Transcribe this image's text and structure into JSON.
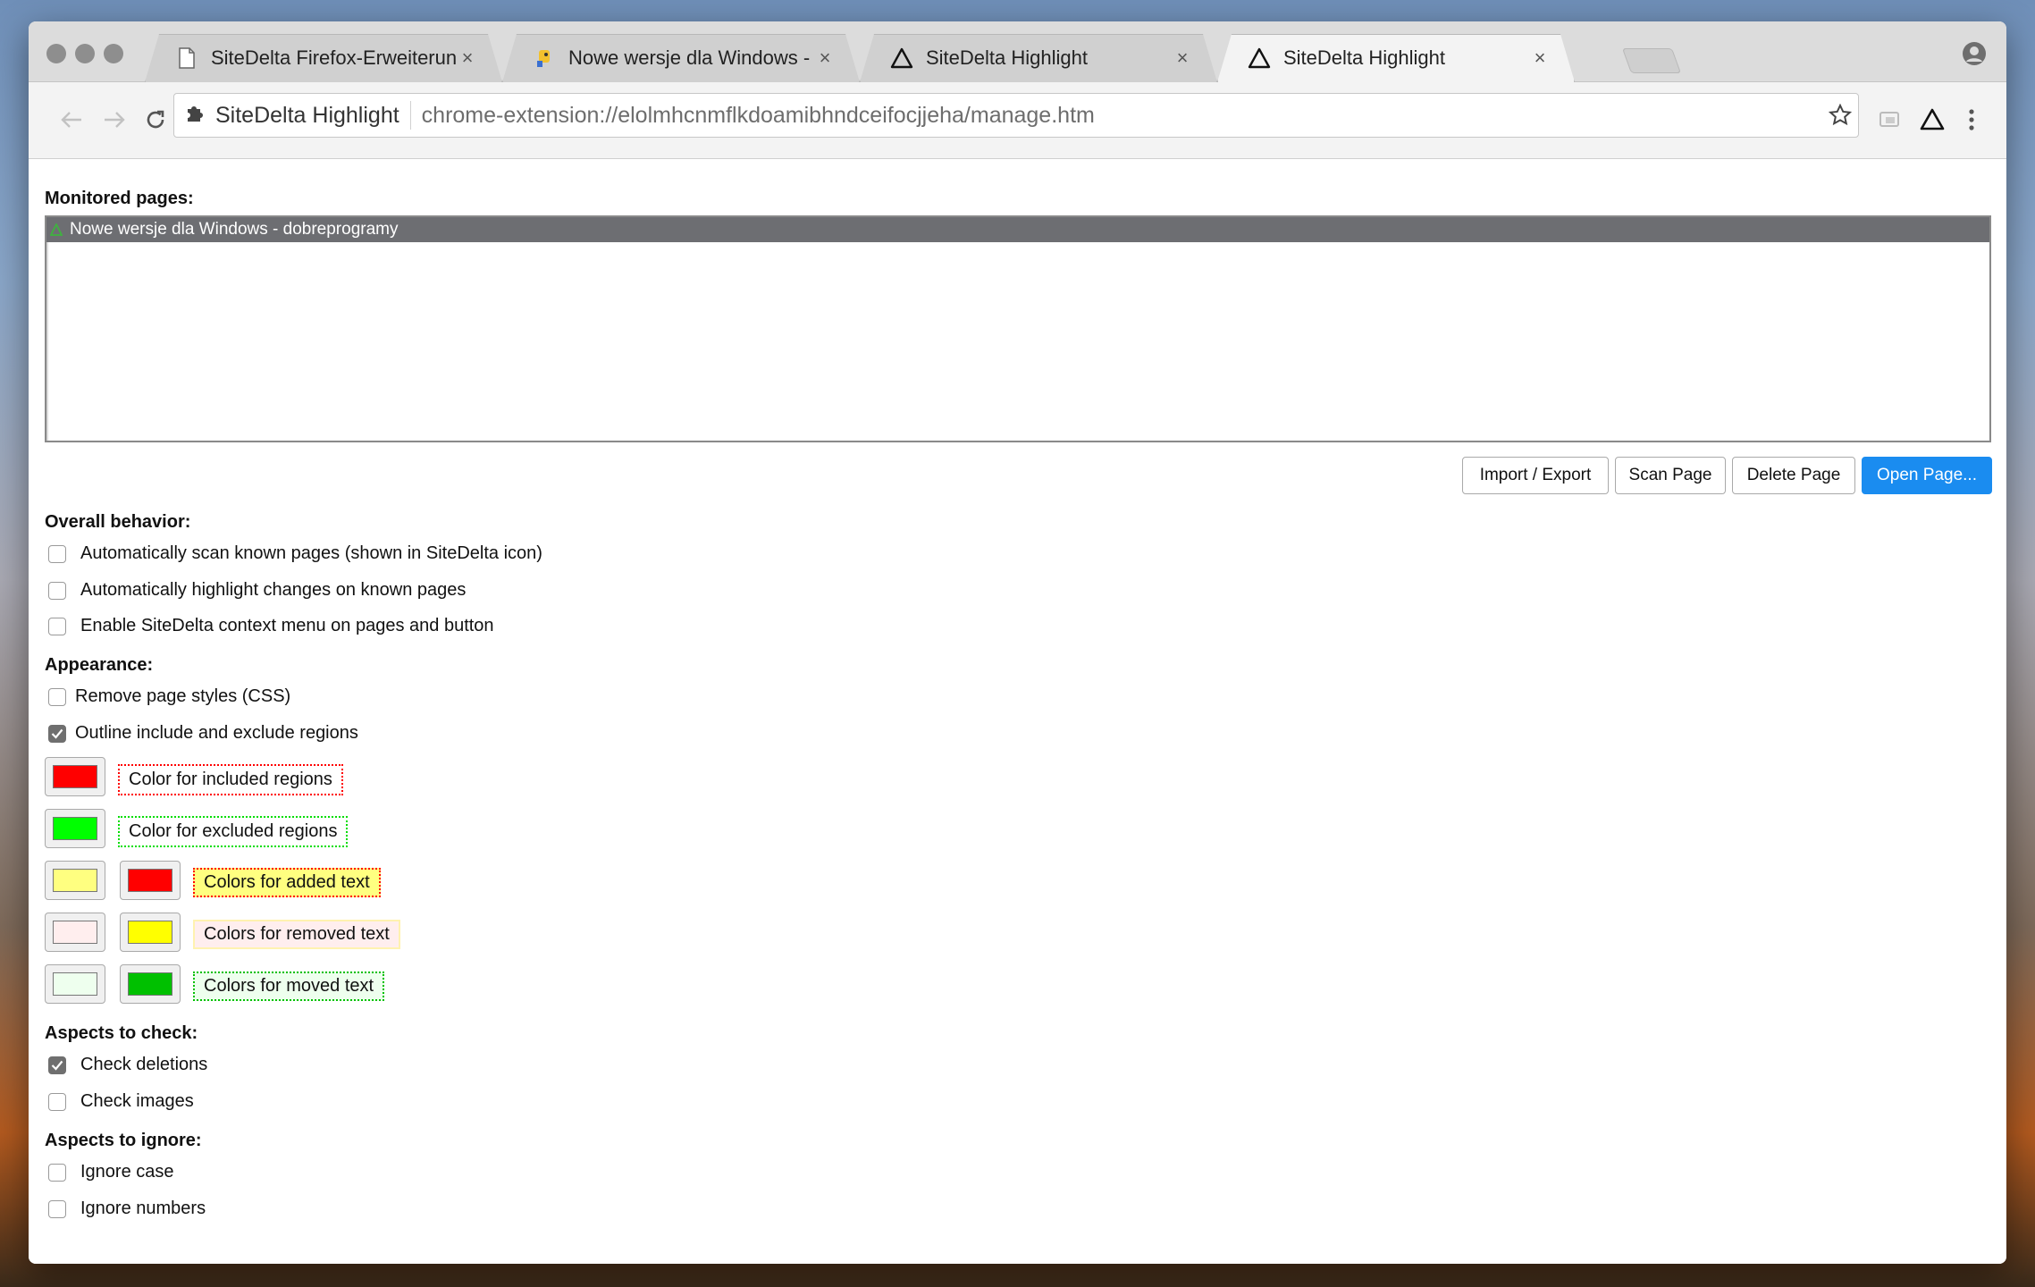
{
  "tabs": [
    {
      "title": "SiteDelta Firefox-Erweiterung",
      "icon": "document-icon",
      "active": false
    },
    {
      "title": "Nowe wersje dla Windows - dobreprogramy",
      "icon": "dobreprogramy-icon",
      "active": false
    },
    {
      "title": "SiteDelta Highlight",
      "icon": "sitedelta-icon",
      "active": false
    },
    {
      "title": "SiteDelta Highlight",
      "icon": "sitedelta-icon",
      "active": true
    }
  ],
  "tab_close_glyph": "×",
  "omnibox": {
    "site_label": "SiteDelta Highlight",
    "url": "chrome-extension://elolmhcnmflkdoamibhndceifocjjeha/manage.htm"
  },
  "monitored": {
    "heading": "Monitored pages:",
    "pages": [
      "Nowe wersje dla Windows - dobreprogramy"
    ]
  },
  "buttons": {
    "import_export": "Import / Export",
    "scan": "Scan Page",
    "delete": "Delete Page",
    "open": "Open Page..."
  },
  "behavior": {
    "heading": "Overall behavior:",
    "options": [
      {
        "label": "Automatically scan known pages (shown in SiteDelta icon)",
        "checked": false
      },
      {
        "label": "Automatically highlight changes on known pages",
        "checked": false
      },
      {
        "label": "Enable SiteDelta context menu on pages and button",
        "checked": false
      }
    ]
  },
  "appearance": {
    "heading": "Appearance:",
    "options": [
      {
        "label": "Remove page styles (CSS)",
        "checked": false
      },
      {
        "label": "Outline include and exclude regions",
        "checked": true
      }
    ],
    "colors": {
      "included": {
        "label": "Color for included regions",
        "color": "#ff0000"
      },
      "excluded": {
        "label": "Color for excluded regions",
        "color": "#00ff00"
      },
      "added": {
        "label": "Colors for added text",
        "background": "#ffff80",
        "border": "#ff0000"
      },
      "removed": {
        "label": "Colors for removed text",
        "background": "#ffeeee",
        "border": "#ffff00"
      },
      "moved": {
        "label": "Colors for moved text",
        "background": "#eeffee",
        "border": "#00c000"
      }
    }
  },
  "check": {
    "heading": "Aspects to check:",
    "options": [
      {
        "label": "Check deletions",
        "checked": true
      },
      {
        "label": "Check images",
        "checked": false
      }
    ]
  },
  "ignore": {
    "heading": "Aspects to ignore:",
    "options": [
      {
        "label": "Ignore case",
        "checked": false
      },
      {
        "label": "Ignore numbers",
        "checked": false
      }
    ]
  },
  "accent_color": "#1a8cf0"
}
